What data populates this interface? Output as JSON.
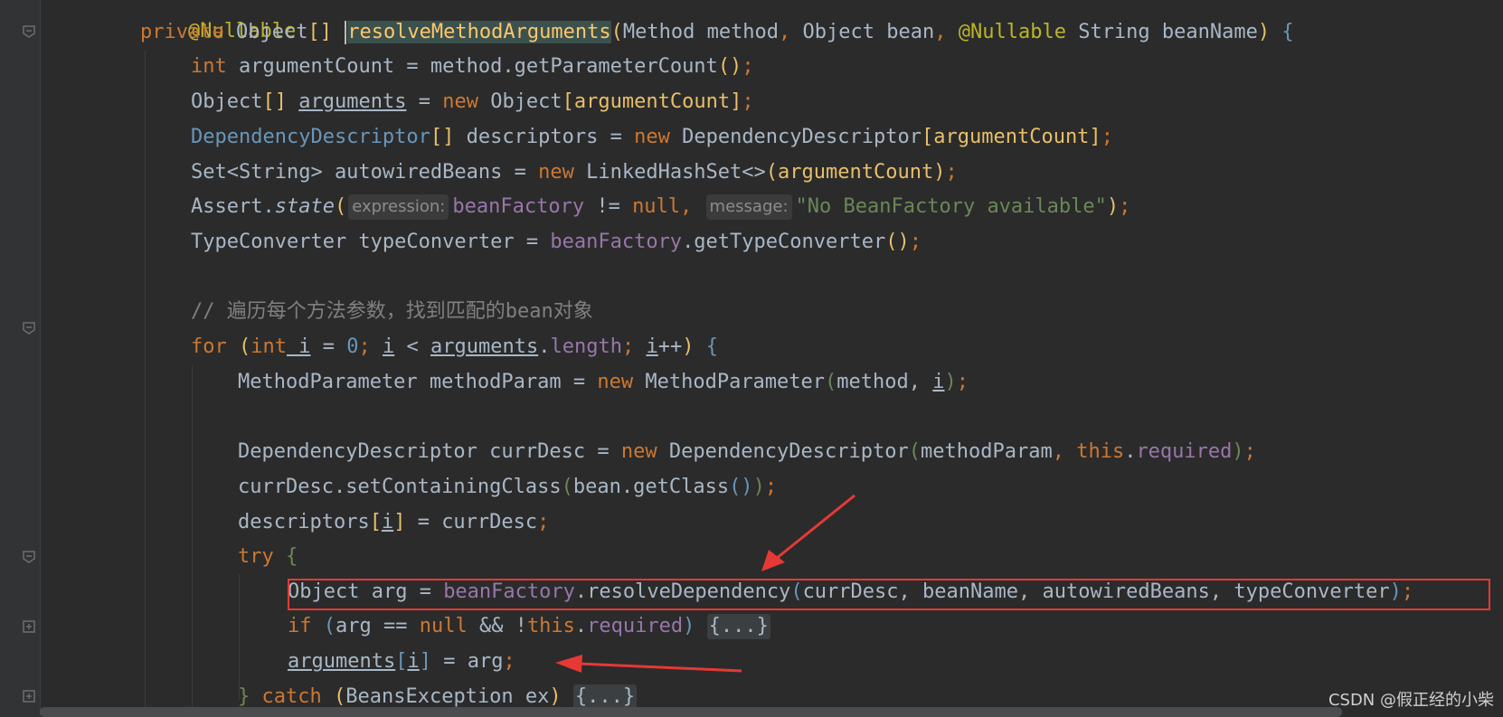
{
  "code": {
    "l0": "@Nullable",
    "l1": {
      "kw_private": "private",
      "type": "Object",
      "brackets": "[]",
      "method": "resolveMethodArguments",
      "p_open": "(",
      "p1": "Method method",
      "c1": ",",
      "p2": " Object bean",
      "c2": ",",
      "ann": " @Nullable",
      "p3": " String beanName",
      "p_close": ")",
      "brace": " {"
    },
    "l2": {
      "kw": "int",
      "rest": " argumentCount = method.getParameterCount",
      "paren": "()",
      "semi": ";"
    },
    "l3": {
      "pre": "Object",
      "br": "[]",
      "var": "arguments",
      "eq": " = ",
      "kw": "new",
      "post": " Object",
      "idx": "[argumentCount]",
      "semi": ";"
    },
    "l4": {
      "type": "DependencyDescriptor",
      "br": "[]",
      "mid": " descriptors = ",
      "kw": "new",
      "post": " DependencyDescriptor",
      "idx": "[argumentCount]",
      "semi": ";"
    },
    "l5": {
      "pre": "Set<String> autowiredBeans = ",
      "kw": "new",
      "post": " LinkedHashSet<>",
      "arg": "(argumentCount)",
      "semi": ";"
    },
    "l6": {
      "pre": "Assert.",
      "method": "state",
      "open": "(",
      "hint1": "expression:",
      "fld": "beanFactory",
      "mid": " != ",
      "kw_null": "null",
      "comma": ",",
      "hint2": "message:",
      "str": "\"No BeanFactory available\"",
      "close": ")",
      "semi": ";"
    },
    "l7": {
      "pre": "TypeConverter typeConverter = ",
      "fld": "beanFactory",
      "post": ".getTypeConverter",
      "paren": "()",
      "semi": ";"
    },
    "l9": "// 遍历每个方法参数，找到匹配的bean对象",
    "l10": {
      "kw_for": "for",
      "open": " (",
      "kw_int": "int",
      "i1": " i",
      "eq": " = ",
      "zero": "0",
      "semi1": "; ",
      "i2": "i",
      "lt": " < ",
      "arr": "arguments",
      "len_dot": ".",
      "len": "length",
      "semi2": "; ",
      "i3": "i",
      "inc": "++",
      "close": ") ",
      "brace": "{"
    },
    "l11": {
      "pre": "MethodParameter methodParam = ",
      "kw": "new",
      "post": " MethodParameter",
      "open": "(",
      "arg1": "method, ",
      "i": "i",
      "close": ")",
      "semi": ";"
    },
    "l13": {
      "pre": "DependencyDescriptor currDesc = ",
      "kw": "new",
      "post": " DependencyDescriptor",
      "open": "(",
      "arg1": "methodParam",
      "comma": ", ",
      "kw_this": "this",
      "dot": ".",
      "fld": "required",
      "close": ")",
      "semi": ";"
    },
    "l14": {
      "pre": "currDesc.setContainingClass",
      "open": "(",
      "mid": "bean.getClass",
      "paren": "()",
      "close": ")",
      "semi": ";"
    },
    "l15": {
      "pre": "descriptors",
      "open": "[",
      "i": "i",
      "close": "]",
      "post": " = currDesc",
      "semi": ";"
    },
    "l16": {
      "kw": "try",
      "brace": " {"
    },
    "l17": {
      "pre": "Object arg = ",
      "fld": "beanFactory",
      "post": ".resolveDependency",
      "open": "(",
      "args": "currDesc, beanName, autowiredBeans, typeConverter",
      "close": ")",
      "semi": ";"
    },
    "l18": {
      "kw_if": "if",
      "open": " (",
      "mid": "arg == ",
      "kw_null": "null",
      "and": " && !",
      "kw_this": "this",
      "dot": ".",
      "fld": "required",
      "close": ")",
      "folded": "{...}"
    },
    "l19": {
      "var": "arguments",
      "open": "[",
      "i": "i",
      "close": "]",
      "post": " = arg",
      "semi": ";"
    },
    "l20": {
      "brace": "} ",
      "kw": "catch",
      "open": " (",
      "mid": "BeansException ex",
      "close": ") ",
      "folded": "{...}"
    }
  },
  "watermark": "CSDN @假正经的小柴",
  "colors": {
    "background": "#2b2b2b",
    "keyword": "#cc7832",
    "annotation": "#bbb529",
    "field": "#9876aa",
    "method": "#ffc66d",
    "string": "#6a8759",
    "number": "#6897bb",
    "comment": "#808080",
    "highlight_box": "#e53935",
    "arrow": "#e53935"
  },
  "icons": [
    "fold-marker-icon",
    "expand-marker-icon",
    "red-arrow-icon"
  ]
}
